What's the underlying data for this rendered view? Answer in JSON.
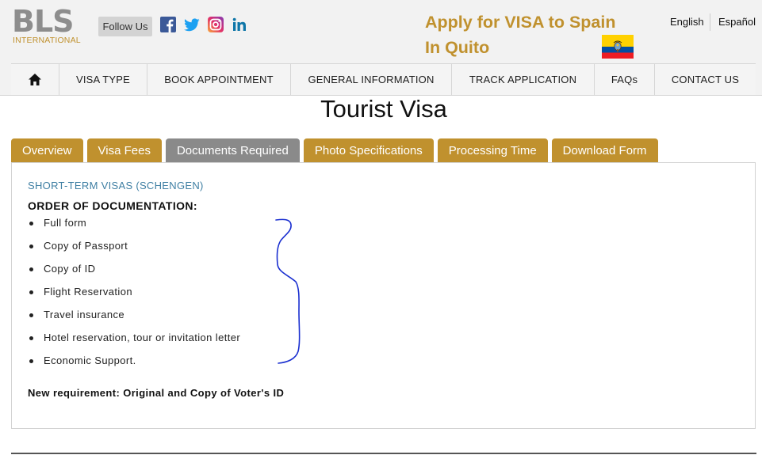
{
  "header": {
    "logo": {
      "main": "BLS",
      "sub": "INTERNATIONAL"
    },
    "follow_label": "Follow Us",
    "social_icons": [
      "facebook-icon",
      "twitter-icon",
      "instagram-icon",
      "linkedin-icon"
    ],
    "headline_line1": "Apply for VISA to Spain",
    "headline_line2": "In Quito",
    "flag": "ecuador-flag",
    "languages": [
      "English",
      "Español"
    ]
  },
  "nav": {
    "home_icon": "home-icon",
    "items": [
      "VISA TYPE",
      "BOOK APPOINTMENT",
      "GENERAL INFORMATION",
      "TRACK APPLICATION",
      "FAQs",
      "CONTACT US"
    ]
  },
  "page": {
    "title": "Tourist Visa",
    "tabs": [
      "Overview",
      "Visa Fees",
      "Documents Required",
      "Photo Specifications",
      "Processing Time",
      "Download Form"
    ],
    "active_tab": "Documents Required"
  },
  "content": {
    "subheading": "SHORT-TERM VISAS (SCHENGEN)",
    "order_title": "ORDER OF DOCUMENTATION:",
    "documents": [
      "Full form",
      "Copy of Passport",
      "Copy of ID",
      "Flight Reservation",
      "Travel insurance",
      "Hotel reservation, tour or invitation letter",
      "Economic Support."
    ],
    "new_requirement": "New requirement: Original and Copy of Voter's ID",
    "annotation": "hand-drawn-brace"
  },
  "colors": {
    "gold": "#c0912e",
    "tab_active": "#8a8a8a",
    "link_blue": "#3f7fa3",
    "annotation_blue": "#1a2fd0"
  }
}
